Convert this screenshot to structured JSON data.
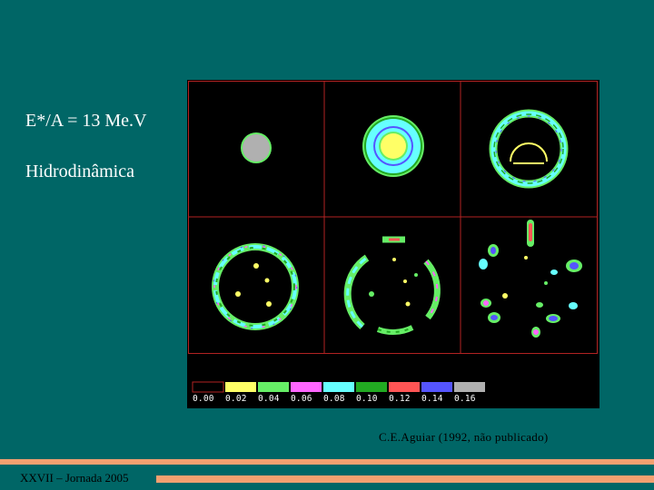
{
  "slide": {
    "title_line1": "E*/A = 13 Me.V",
    "title_line2": "Hidrodinâmica",
    "credit": "C.E.Aguiar (1992, não publicado)",
    "footer": "XXVII – Jornada 2005"
  },
  "figure": {
    "grid_color": "#b22222",
    "legend": [
      {
        "label": "0.00",
        "color": "#000000"
      },
      {
        "label": "0.02",
        "color": "#ffff66"
      },
      {
        "label": "0.04",
        "color": "#66ee66"
      },
      {
        "label": "0.06",
        "color": "#ff66ff"
      },
      {
        "label": "0.08",
        "color": "#66ffff"
      },
      {
        "label": "0.10",
        "color": "#22aa22"
      },
      {
        "label": "0.12",
        "color": "#ff5555"
      },
      {
        "label": "0.14",
        "color": "#5555ff"
      },
      {
        "label": "0.16",
        "color": "#b0b0b0"
      }
    ]
  },
  "colors": {
    "background": "#006666",
    "accent_bar": "#f4a070"
  }
}
